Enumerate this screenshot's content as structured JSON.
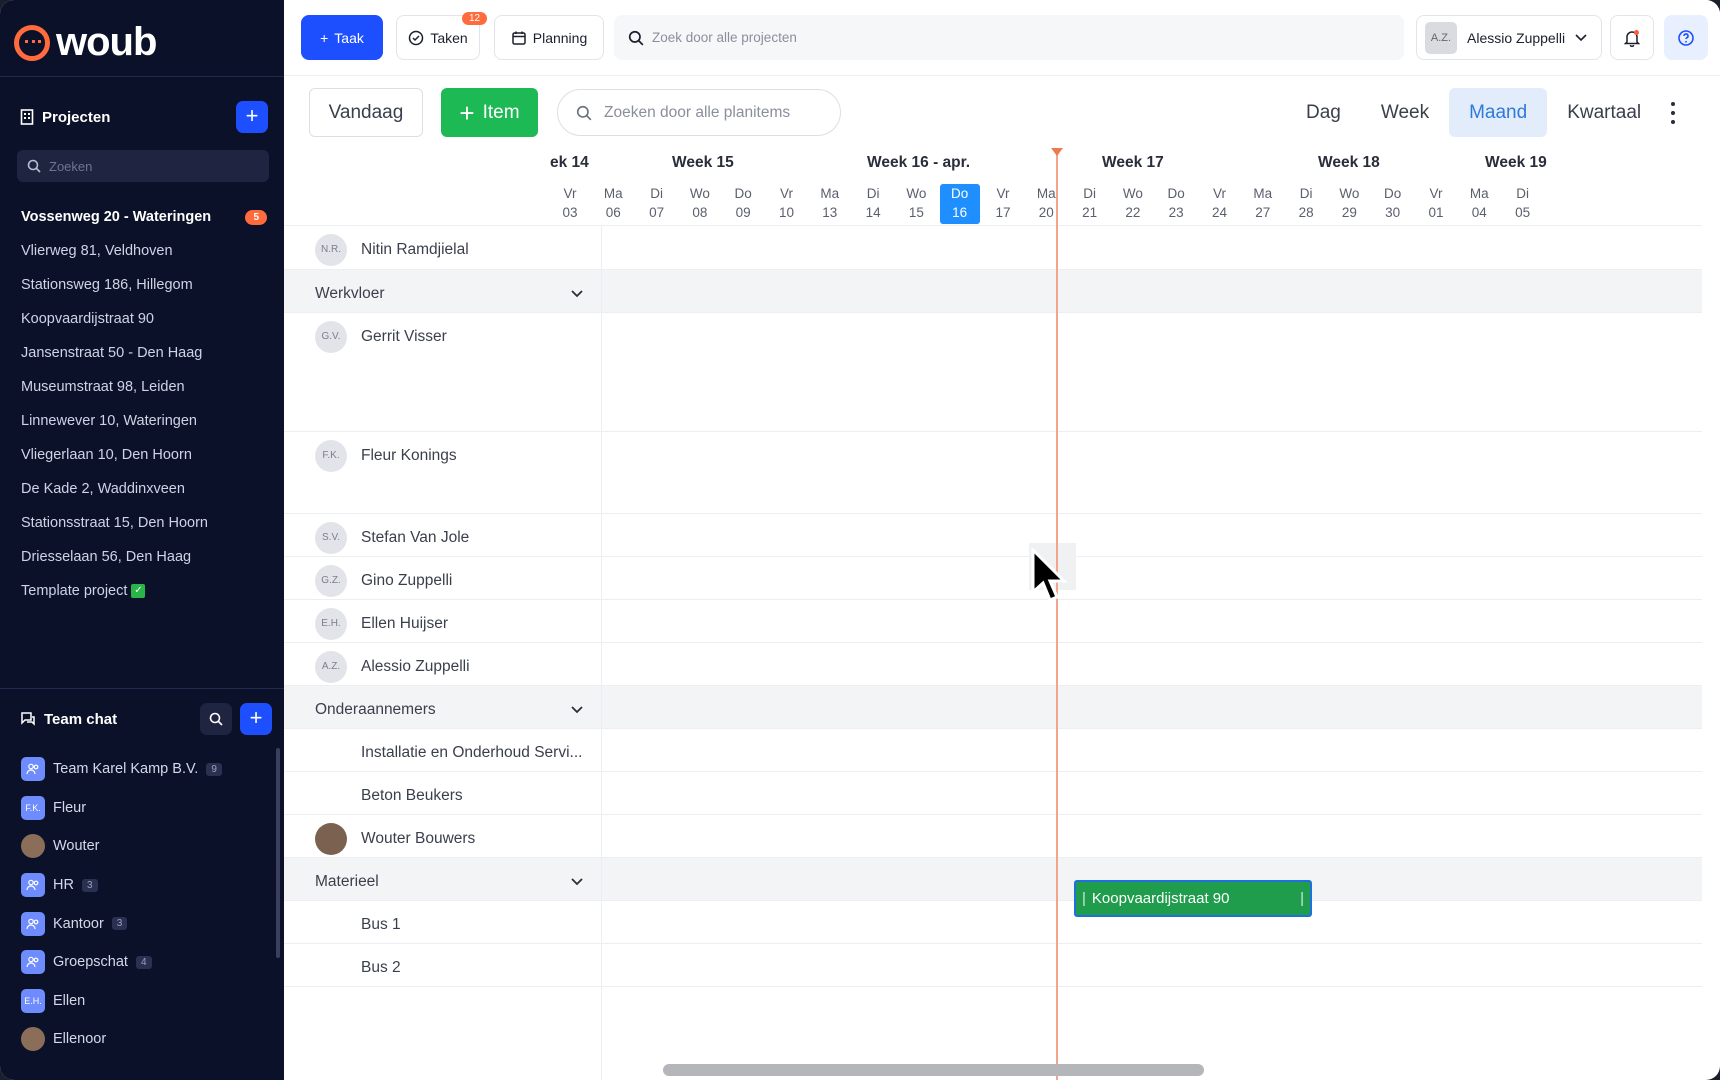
{
  "brand": {
    "name": "woub"
  },
  "sidebar": {
    "projects_title": "Projecten",
    "search_placeholder": "Zoeken",
    "projects": [
      {
        "label": "Vossenweg 20 - Wateringen",
        "badge": "5",
        "active": true
      },
      {
        "label": "Vlierweg 81, Veldhoven"
      },
      {
        "label": "Stationsweg 186, Hillegom"
      },
      {
        "label": "Koopvaardijstraat 90"
      },
      {
        "label": "Jansenstraat 50 - Den Haag"
      },
      {
        "label": "Museumstraat 98, Leiden"
      },
      {
        "label": "Linnewever 10, Wateringen"
      },
      {
        "label": "Vliegerlaan 10, Den Hoorn"
      },
      {
        "label": "De Kade 2, Waddinxveen"
      },
      {
        "label": "Stationsstraat 15, Den Hoorn"
      },
      {
        "label": "Driesselaan 56, Den Haag"
      },
      {
        "label": "Template project",
        "check": "✓"
      }
    ],
    "chat_title": "Team chat",
    "chats": [
      {
        "label": "Team Karel Kamp B.V.",
        "count": "9",
        "icon": "group-icon"
      },
      {
        "label": "Fleur",
        "initials": "F.K."
      },
      {
        "label": "Wouter",
        "photo": true
      },
      {
        "label": "HR",
        "count": "3",
        "icon": "group-icon"
      },
      {
        "label": "Kantoor",
        "count": "3",
        "icon": "group-icon"
      },
      {
        "label": "Groepschat",
        "count": "4",
        "icon": "group-icon"
      },
      {
        "label": "Ellen",
        "initials": "E.H."
      },
      {
        "label": "Ellenoor",
        "photo": true
      }
    ]
  },
  "topbar": {
    "task_button": "Taak",
    "tasks_button": "Taken",
    "tasks_badge": "12",
    "planning_button": "Planning",
    "search_placeholder": "Zoek door alle projecten",
    "user": {
      "initials": "A.Z.",
      "name": "Alessio Zuppelli"
    }
  },
  "toolbar": {
    "today": "Vandaag",
    "item": "Item",
    "search_placeholder": "Zoeken door alle planitems",
    "views": [
      "Dag",
      "Week",
      "Maand",
      "Kwartaal"
    ],
    "active_view": "Maand"
  },
  "timeline": {
    "weeks": [
      "ek 14",
      "Week 15",
      "Week 16 - apr.",
      "Week 17",
      "Week 18",
      "Week 19"
    ],
    "days": [
      {
        "d": "Vr",
        "n": "03"
      },
      {
        "d": "Ma",
        "n": "06"
      },
      {
        "d": "Di",
        "n": "07"
      },
      {
        "d": "Wo",
        "n": "08"
      },
      {
        "d": "Do",
        "n": "09"
      },
      {
        "d": "Vr",
        "n": "10"
      },
      {
        "d": "Ma",
        "n": "13"
      },
      {
        "d": "Di",
        "n": "14"
      },
      {
        "d": "Wo",
        "n": "15"
      },
      {
        "d": "Do",
        "n": "16",
        "today": true
      },
      {
        "d": "Vr",
        "n": "17"
      },
      {
        "d": "Ma",
        "n": "20"
      },
      {
        "d": "Di",
        "n": "21"
      },
      {
        "d": "Wo",
        "n": "22"
      },
      {
        "d": "Do",
        "n": "23"
      },
      {
        "d": "Vr",
        "n": "24"
      },
      {
        "d": "Ma",
        "n": "27"
      },
      {
        "d": "Di",
        "n": "28"
      },
      {
        "d": "Wo",
        "n": "29"
      },
      {
        "d": "Do",
        "n": "30"
      },
      {
        "d": "Vr",
        "n": "01"
      },
      {
        "d": "Ma",
        "n": "04"
      },
      {
        "d": "Di",
        "n": "05"
      }
    ],
    "rows": [
      {
        "type": "person",
        "initials": "N.R.",
        "label": "Nitin Ramdjielal"
      },
      {
        "type": "group",
        "label": "Werkvloer"
      },
      {
        "type": "person",
        "initials": "G.V.",
        "label": "Gerrit Visser"
      },
      {
        "type": "person",
        "initials": "F.K.",
        "label": "Fleur Konings"
      },
      {
        "type": "person",
        "initials": "S.V.",
        "label": "Stefan Van Jole"
      },
      {
        "type": "person",
        "initials": "G.Z.",
        "label": "Gino Zuppelli"
      },
      {
        "type": "person",
        "initials": "E.H.",
        "label": "Ellen Huijser"
      },
      {
        "type": "person",
        "initials": "A.Z.",
        "label": "Alessio Zuppelli"
      },
      {
        "type": "group",
        "label": "Onderaannemers"
      },
      {
        "type": "plain",
        "label": "Installatie en Onderhoud Servi..."
      },
      {
        "type": "plain",
        "label": "Beton Beukers"
      },
      {
        "type": "person",
        "photo": true,
        "label": "Wouter Bouwers"
      },
      {
        "type": "group",
        "label": "Materieel"
      },
      {
        "type": "plain",
        "label": "Bus 1"
      },
      {
        "type": "plain",
        "label": "Bus 2"
      }
    ],
    "event": {
      "label": "Koopvaardijstraat 90",
      "color": "#1f9d4c"
    }
  }
}
